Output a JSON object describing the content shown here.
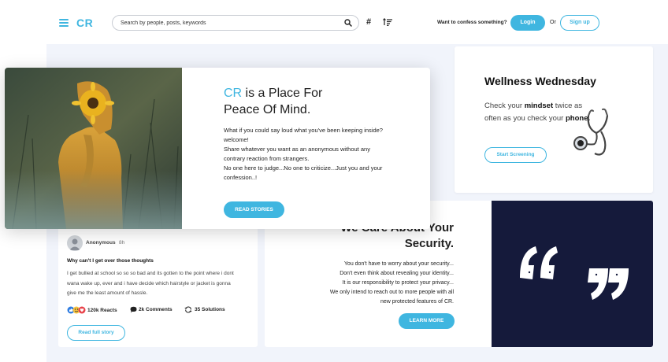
{
  "header": {
    "logo": "CR",
    "search_placeholder": "Search by people, posts, keywords",
    "confess_text": "Want to confess something?",
    "login_label": "Login",
    "or_text": "Or",
    "signup_label": "Sign up"
  },
  "hero": {
    "title_accent": "CR",
    "title_line1_rest": " is a Place For",
    "title_line2": "Peace Of Mind.",
    "lines": [
      "What if you could say loud what you've been keeping inside?",
      "welcome!",
      "Share whatever you want as an anonymous without any contrary reaction from strangers.",
      "No one here to judge...No one to criticize...Just you and your confession..!"
    ],
    "button_label": "READ STORIES"
  },
  "wellness": {
    "title": "Wellness Wednesday",
    "text_before": "Check your ",
    "text_bold1": "mindset",
    "text_middle": " twice as often as you check your ",
    "text_bold2": "phone.",
    "button_label": "Start Screening"
  },
  "security": {
    "title_line1": "We Care About Your",
    "title_line2": "Security.",
    "lines": [
      "You don't have to worry about your security...",
      "Don't even think about revealing your identity...",
      "It is our responsibility to protect your privacy...",
      "We only intend to reach out to more people with all",
      "new protected features of CR."
    ],
    "button_label": "LEARN MORE"
  },
  "story": {
    "author": "Anonymous",
    "age": "8h",
    "title": "Why can't I get over those thoughts",
    "body": "I get bullied at school so so so bad and its gotten to the point where i dont wana wake up, ever and i have decide which hairstyle or jacket is gonna give me the least amount of hassle.",
    "reacts": "120k Reacts",
    "comments": "2k Comments",
    "solutions": "35 Solutions",
    "button_label": "Read full story"
  },
  "colors": {
    "accent": "#3fb6e0",
    "navy": "#151a3b",
    "background": "#f1f4fb"
  }
}
